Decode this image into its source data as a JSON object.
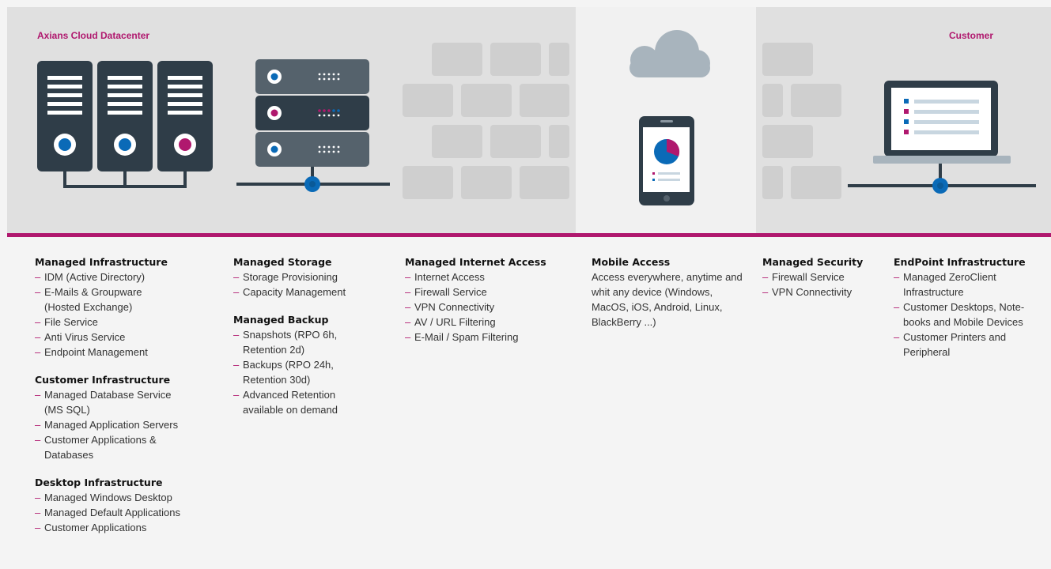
{
  "header": {
    "left_label": "Axians Cloud Datacenter",
    "right_label": "Customer"
  },
  "colors": {
    "accent": "#b0186e",
    "server": "#2f3d48",
    "node": "#0a6ab7",
    "brick": "#cfcfcf",
    "cloud": "#a8b4bd"
  },
  "icons": [
    "server-rack-icon",
    "storage-array-icon",
    "firewall-wall-icon",
    "cloud-icon",
    "smartphone-icon",
    "laptop-icon",
    "network-node-icon"
  ],
  "columns": [
    {
      "sections": [
        {
          "title": "Managed Infrastructure",
          "items": [
            "IDM (Active Directory)",
            "E-Mails & Groupware (Hosted Exchange)",
            "File Service",
            "Anti Virus Service",
            "Endpoint Management"
          ]
        },
        {
          "title": "Customer Infrastructure",
          "items": [
            "Managed Database Service (MS SQL)",
            "Managed Application Servers",
            "Customer Applications & Databases"
          ]
        },
        {
          "title": "Desktop Infrastructure",
          "items": [
            "Managed Windows Desktop",
            "Managed Default Applications",
            "Customer Applications"
          ]
        }
      ]
    },
    {
      "sections": [
        {
          "title": "Managed Storage",
          "items": [
            "Storage Provisioning",
            "Capacity Management"
          ]
        },
        {
          "title": "Managed Backup",
          "items": [
            "Snapshots (RPO 6h, Retention 2d)",
            "Backups (RPO 24h, Retention 30d)",
            "Advanced Retention available on demand"
          ]
        }
      ]
    },
    {
      "sections": [
        {
          "title": "Managed Internet Access",
          "items": [
            "Internet Access",
            "Firewall Service",
            "VPN Connectivity",
            "AV / URL Filtering",
            "E-Mail / Spam Filtering"
          ]
        }
      ]
    },
    {
      "sections": [
        {
          "title": "Mobile Access",
          "text": "Access everywhere, anytime and whit any device (Windows, MacOS, iOS, Android, Linux, BlackBerry ...)"
        }
      ]
    },
    {
      "sections": [
        {
          "title": "Managed Security",
          "items": [
            "Firewall Service",
            "VPN Connectivity"
          ]
        }
      ]
    },
    {
      "sections": [
        {
          "title": "EndPoint Infrastructure",
          "items": [
            "Managed ZeroClient Infrastructure",
            "Customer Desktops, Note-books and Mobile Devices",
            "Customer Printers and Peripheral"
          ]
        }
      ]
    }
  ]
}
